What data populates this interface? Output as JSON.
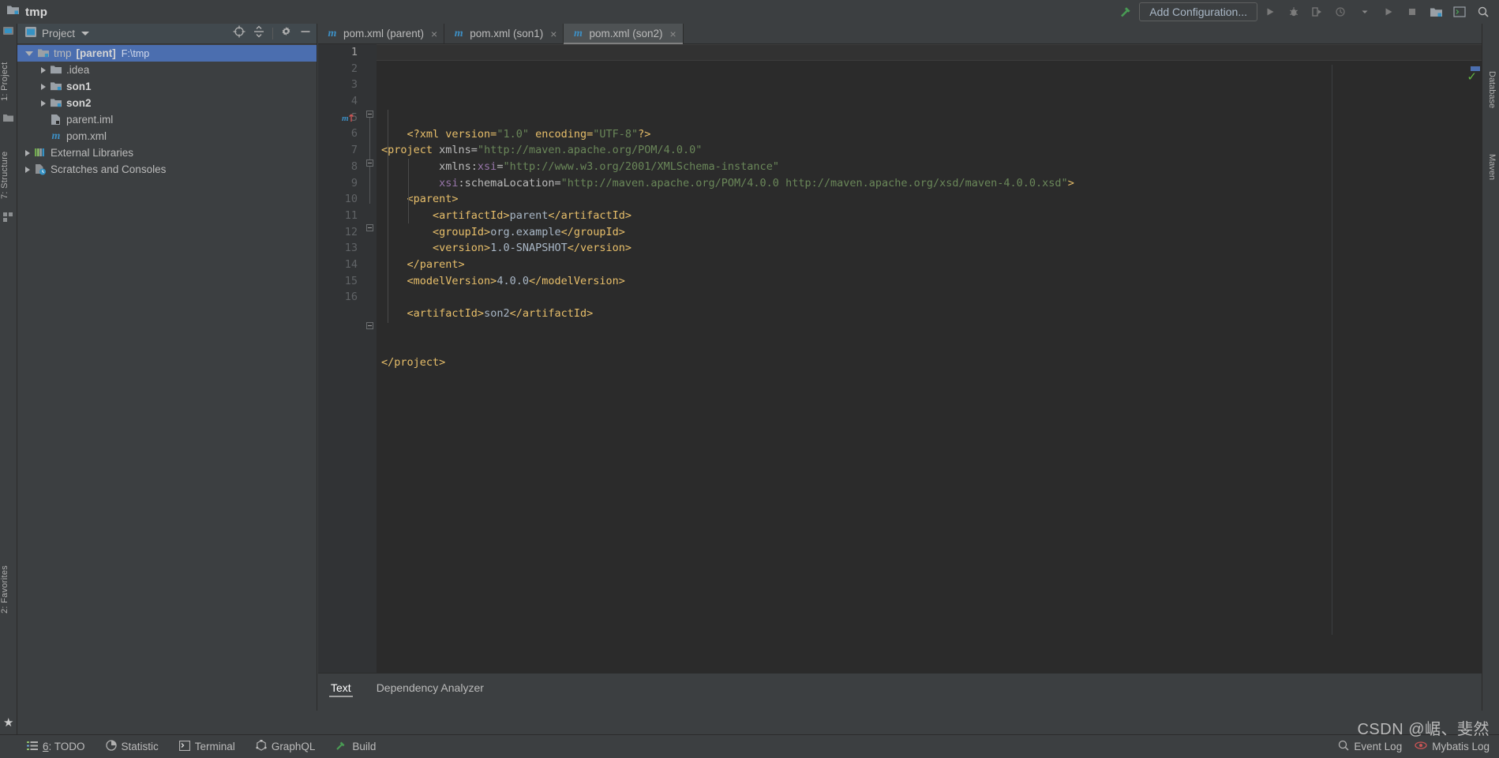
{
  "window": {
    "project_name": "tmp",
    "project_icon": "folder-module-icon"
  },
  "toolbar": {
    "build_icon": "hammer-icon",
    "run_config_label": "Add Configuration...",
    "buttons": [
      {
        "name": "run-button",
        "icon": "play-icon"
      },
      {
        "name": "debug-button",
        "icon": "bug-icon"
      },
      {
        "name": "run-coverage-button",
        "icon": "coverage-icon"
      },
      {
        "name": "profiler-button",
        "icon": "profiler-icon"
      },
      {
        "name": "profiler-dropdown",
        "icon": "chevron-down-icon"
      },
      {
        "name": "run-anything-button",
        "icon": "play-icon"
      },
      {
        "name": "stop-button",
        "icon": "stop-square-icon"
      },
      {
        "name": "project-structure-button",
        "icon": "module-icon"
      },
      {
        "name": "terminal-button",
        "icon": "terminal-icon"
      },
      {
        "name": "search-everywhere-button",
        "icon": "search-icon"
      }
    ]
  },
  "left_rail": {
    "items": [
      {
        "name": "rail-project",
        "label": "1: Project"
      },
      {
        "name": "rail-structure",
        "label": "7: Structure"
      },
      {
        "name": "rail-favorites",
        "label": "2: Favorites"
      }
    ]
  },
  "right_rail": {
    "items": [
      {
        "name": "rail-database",
        "label": "Database"
      },
      {
        "name": "rail-maven",
        "label": "Maven"
      }
    ]
  },
  "project_panel": {
    "title": "Project",
    "title_icon": "project-view-icon",
    "tools": [
      {
        "name": "locate-icon",
        "icon": "target-icon"
      },
      {
        "name": "collapse-all-icon",
        "icon": "collapse-icon"
      },
      {
        "name": "gear-icon",
        "icon": "gear-icon"
      },
      {
        "name": "hide-panel-icon",
        "icon": "minus-icon"
      }
    ],
    "tree": [
      {
        "name": "tree-node-tmp",
        "label": "tmp",
        "suffix": "[parent]",
        "path": "F:\\tmp",
        "icon": "module-folder-icon",
        "indent": 0,
        "arrow": "open",
        "selected": true,
        "bold": false
      },
      {
        "name": "tree-node-idea",
        "label": ".idea",
        "suffix": "",
        "path": "",
        "icon": "folder-icon",
        "indent": 1,
        "arrow": "closed",
        "selected": false,
        "bold": false
      },
      {
        "name": "tree-node-son1",
        "label": "son1",
        "suffix": "",
        "path": "",
        "icon": "module-folder-icon",
        "indent": 1,
        "arrow": "closed",
        "selected": false,
        "bold": true
      },
      {
        "name": "tree-node-son2",
        "label": "son2",
        "suffix": "",
        "path": "",
        "icon": "module-folder-icon",
        "indent": 1,
        "arrow": "closed",
        "selected": false,
        "bold": true
      },
      {
        "name": "tree-node-parent-iml",
        "label": "parent.iml",
        "suffix": "",
        "path": "",
        "icon": "iml-file-icon",
        "indent": 1,
        "arrow": "none",
        "selected": false,
        "bold": false
      },
      {
        "name": "tree-node-pom-xml",
        "label": "pom.xml",
        "suffix": "",
        "path": "",
        "icon": "maven-m-icon",
        "indent": 1,
        "arrow": "none",
        "selected": false,
        "bold": false
      },
      {
        "name": "tree-node-external-libraries",
        "label": "External Libraries",
        "suffix": "",
        "path": "",
        "icon": "libraries-icon",
        "indent": 0,
        "arrow": "closed",
        "selected": false,
        "bold": false
      },
      {
        "name": "tree-node-scratches",
        "label": "Scratches and Consoles",
        "suffix": "",
        "path": "",
        "icon": "scratches-icon",
        "indent": 0,
        "arrow": "closed",
        "selected": false,
        "bold": false
      }
    ]
  },
  "editor": {
    "tabs": [
      {
        "name": "tab-pom-parent",
        "label": "pom.xml (parent)",
        "icon": "maven-m-icon",
        "active": false
      },
      {
        "name": "tab-pom-son1",
        "label": "pom.xml (son1)",
        "icon": "maven-m-icon",
        "active": false
      },
      {
        "name": "tab-pom-son2",
        "label": "pom.xml (son2)",
        "icon": "maven-m-icon",
        "active": true
      }
    ],
    "close_glyph": "×",
    "line_numbers": [
      "1",
      "2",
      "3",
      "4",
      "5",
      "6",
      "7",
      "8",
      "9",
      "10",
      "11",
      "12",
      "13",
      "14",
      "15",
      "16"
    ],
    "current_line": 1,
    "gutter_marker_line": 5,
    "gutter_marker_icon": "maven-parent-navigate-icon",
    "inspection_status": "✓",
    "code_lines": [
      {
        "n": 1,
        "tokens": [
          {
            "t": "    ",
            "c": "t-txt"
          },
          {
            "t": "<?xml version=",
            "c": "t-pi"
          },
          {
            "t": "\"1.0\"",
            "c": "t-str"
          },
          {
            "t": " encoding=",
            "c": "t-pi"
          },
          {
            "t": "\"UTF-8\"",
            "c": "t-str"
          },
          {
            "t": "?>",
            "c": "t-pi"
          }
        ]
      },
      {
        "n": 2,
        "tokens": [
          {
            "t": "<project",
            "c": "t-tag"
          },
          {
            "t": " xmlns=",
            "c": "t-attr"
          },
          {
            "t": "\"http://maven.apache.org/POM/4.0.0\"",
            "c": "t-str"
          }
        ]
      },
      {
        "n": 3,
        "tokens": [
          {
            "t": "         xmlns:",
            "c": "t-attr"
          },
          {
            "t": "xsi",
            "c": "t-ns"
          },
          {
            "t": "=",
            "c": "t-attr"
          },
          {
            "t": "\"http://www.w3.org/2001/XMLSchema-instance\"",
            "c": "t-str"
          }
        ]
      },
      {
        "n": 4,
        "tokens": [
          {
            "t": "         ",
            "c": "t-attr"
          },
          {
            "t": "xsi",
            "c": "t-ns"
          },
          {
            "t": ":schemaLocation=",
            "c": "t-attr"
          },
          {
            "t": "\"http://maven.apache.org/POM/4.0.0 http://maven.apache.org/xsd/maven-4.0.0.xsd\"",
            "c": "t-str"
          },
          {
            "t": ">",
            "c": "t-tag"
          }
        ]
      },
      {
        "n": 5,
        "tokens": [
          {
            "t": "    ",
            "c": "t-txt"
          },
          {
            "t": "<parent>",
            "c": "t-tag"
          }
        ]
      },
      {
        "n": 6,
        "tokens": [
          {
            "t": "        ",
            "c": "t-txt"
          },
          {
            "t": "<artifactId>",
            "c": "t-tag"
          },
          {
            "t": "parent",
            "c": "t-txt"
          },
          {
            "t": "</artifactId>",
            "c": "t-tag"
          }
        ]
      },
      {
        "n": 7,
        "tokens": [
          {
            "t": "        ",
            "c": "t-txt"
          },
          {
            "t": "<groupId>",
            "c": "t-tag"
          },
          {
            "t": "org.example",
            "c": "t-txt"
          },
          {
            "t": "</groupId>",
            "c": "t-tag"
          }
        ]
      },
      {
        "n": 8,
        "tokens": [
          {
            "t": "        ",
            "c": "t-txt"
          },
          {
            "t": "<version>",
            "c": "t-tag"
          },
          {
            "t": "1.0-SNAPSHOT",
            "c": "t-txt"
          },
          {
            "t": "</version>",
            "c": "t-tag"
          }
        ]
      },
      {
        "n": 9,
        "tokens": [
          {
            "t": "    ",
            "c": "t-txt"
          },
          {
            "t": "</parent>",
            "c": "t-tag"
          }
        ]
      },
      {
        "n": 10,
        "tokens": [
          {
            "t": "    ",
            "c": "t-txt"
          },
          {
            "t": "<modelVersion>",
            "c": "t-tag"
          },
          {
            "t": "4.0.0",
            "c": "t-txt"
          },
          {
            "t": "</modelVersion>",
            "c": "t-tag"
          }
        ]
      },
      {
        "n": 11,
        "tokens": [
          {
            "t": "",
            "c": "t-txt"
          }
        ]
      },
      {
        "n": 12,
        "tokens": [
          {
            "t": "    ",
            "c": "t-txt"
          },
          {
            "t": "<artifactId>",
            "c": "t-tag"
          },
          {
            "t": "son2",
            "c": "t-txt"
          },
          {
            "t": "</artifactId>",
            "c": "t-tag"
          }
        ]
      },
      {
        "n": 13,
        "tokens": [
          {
            "t": "",
            "c": "t-txt"
          }
        ]
      },
      {
        "n": 14,
        "tokens": [
          {
            "t": "",
            "c": "t-txt"
          }
        ]
      },
      {
        "n": 15,
        "tokens": [
          {
            "t": "</project>",
            "c": "t-tag"
          }
        ]
      },
      {
        "n": 16,
        "tokens": [
          {
            "t": "",
            "c": "t-txt"
          }
        ]
      }
    ],
    "bottom_tabs": [
      {
        "name": "editor-tab-text",
        "label": "Text",
        "active": true
      },
      {
        "name": "editor-tab-dependency-analyzer",
        "label": "Dependency Analyzer",
        "active": false
      }
    ]
  },
  "statusbar": {
    "items": [
      {
        "name": "status-todo",
        "label": "6: TODO",
        "icon": "todo-list-icon",
        "underline_first": true
      },
      {
        "name": "status-statistic",
        "label": "Statistic",
        "icon": "pie-chart-icon",
        "underline_first": false
      },
      {
        "name": "status-terminal",
        "label": "Terminal",
        "icon": "terminal-icon",
        "underline_first": false
      },
      {
        "name": "status-graphql",
        "label": "GraphQL",
        "icon": "graphql-icon",
        "underline_first": false
      },
      {
        "name": "status-build",
        "label": "Build",
        "icon": "hammer-icon",
        "underline_first": false
      }
    ],
    "right": [
      {
        "name": "status-event-log",
        "label": "Event Log",
        "icon": "event-log-icon"
      },
      {
        "name": "status-mybatis-log",
        "label": "Mybatis Log",
        "icon": "mybatis-icon"
      }
    ]
  },
  "watermark": {
    "line1": "CSDN @崌、斐然",
    "line2": ""
  },
  "colors": {
    "accent_blue": "#4b6eaf",
    "maven_blue": "#3d8fc4",
    "tag_orange": "#e8bf6a",
    "string_green": "#6a8759",
    "ns_purple": "#9876aa",
    "ok_green": "#62b543"
  }
}
